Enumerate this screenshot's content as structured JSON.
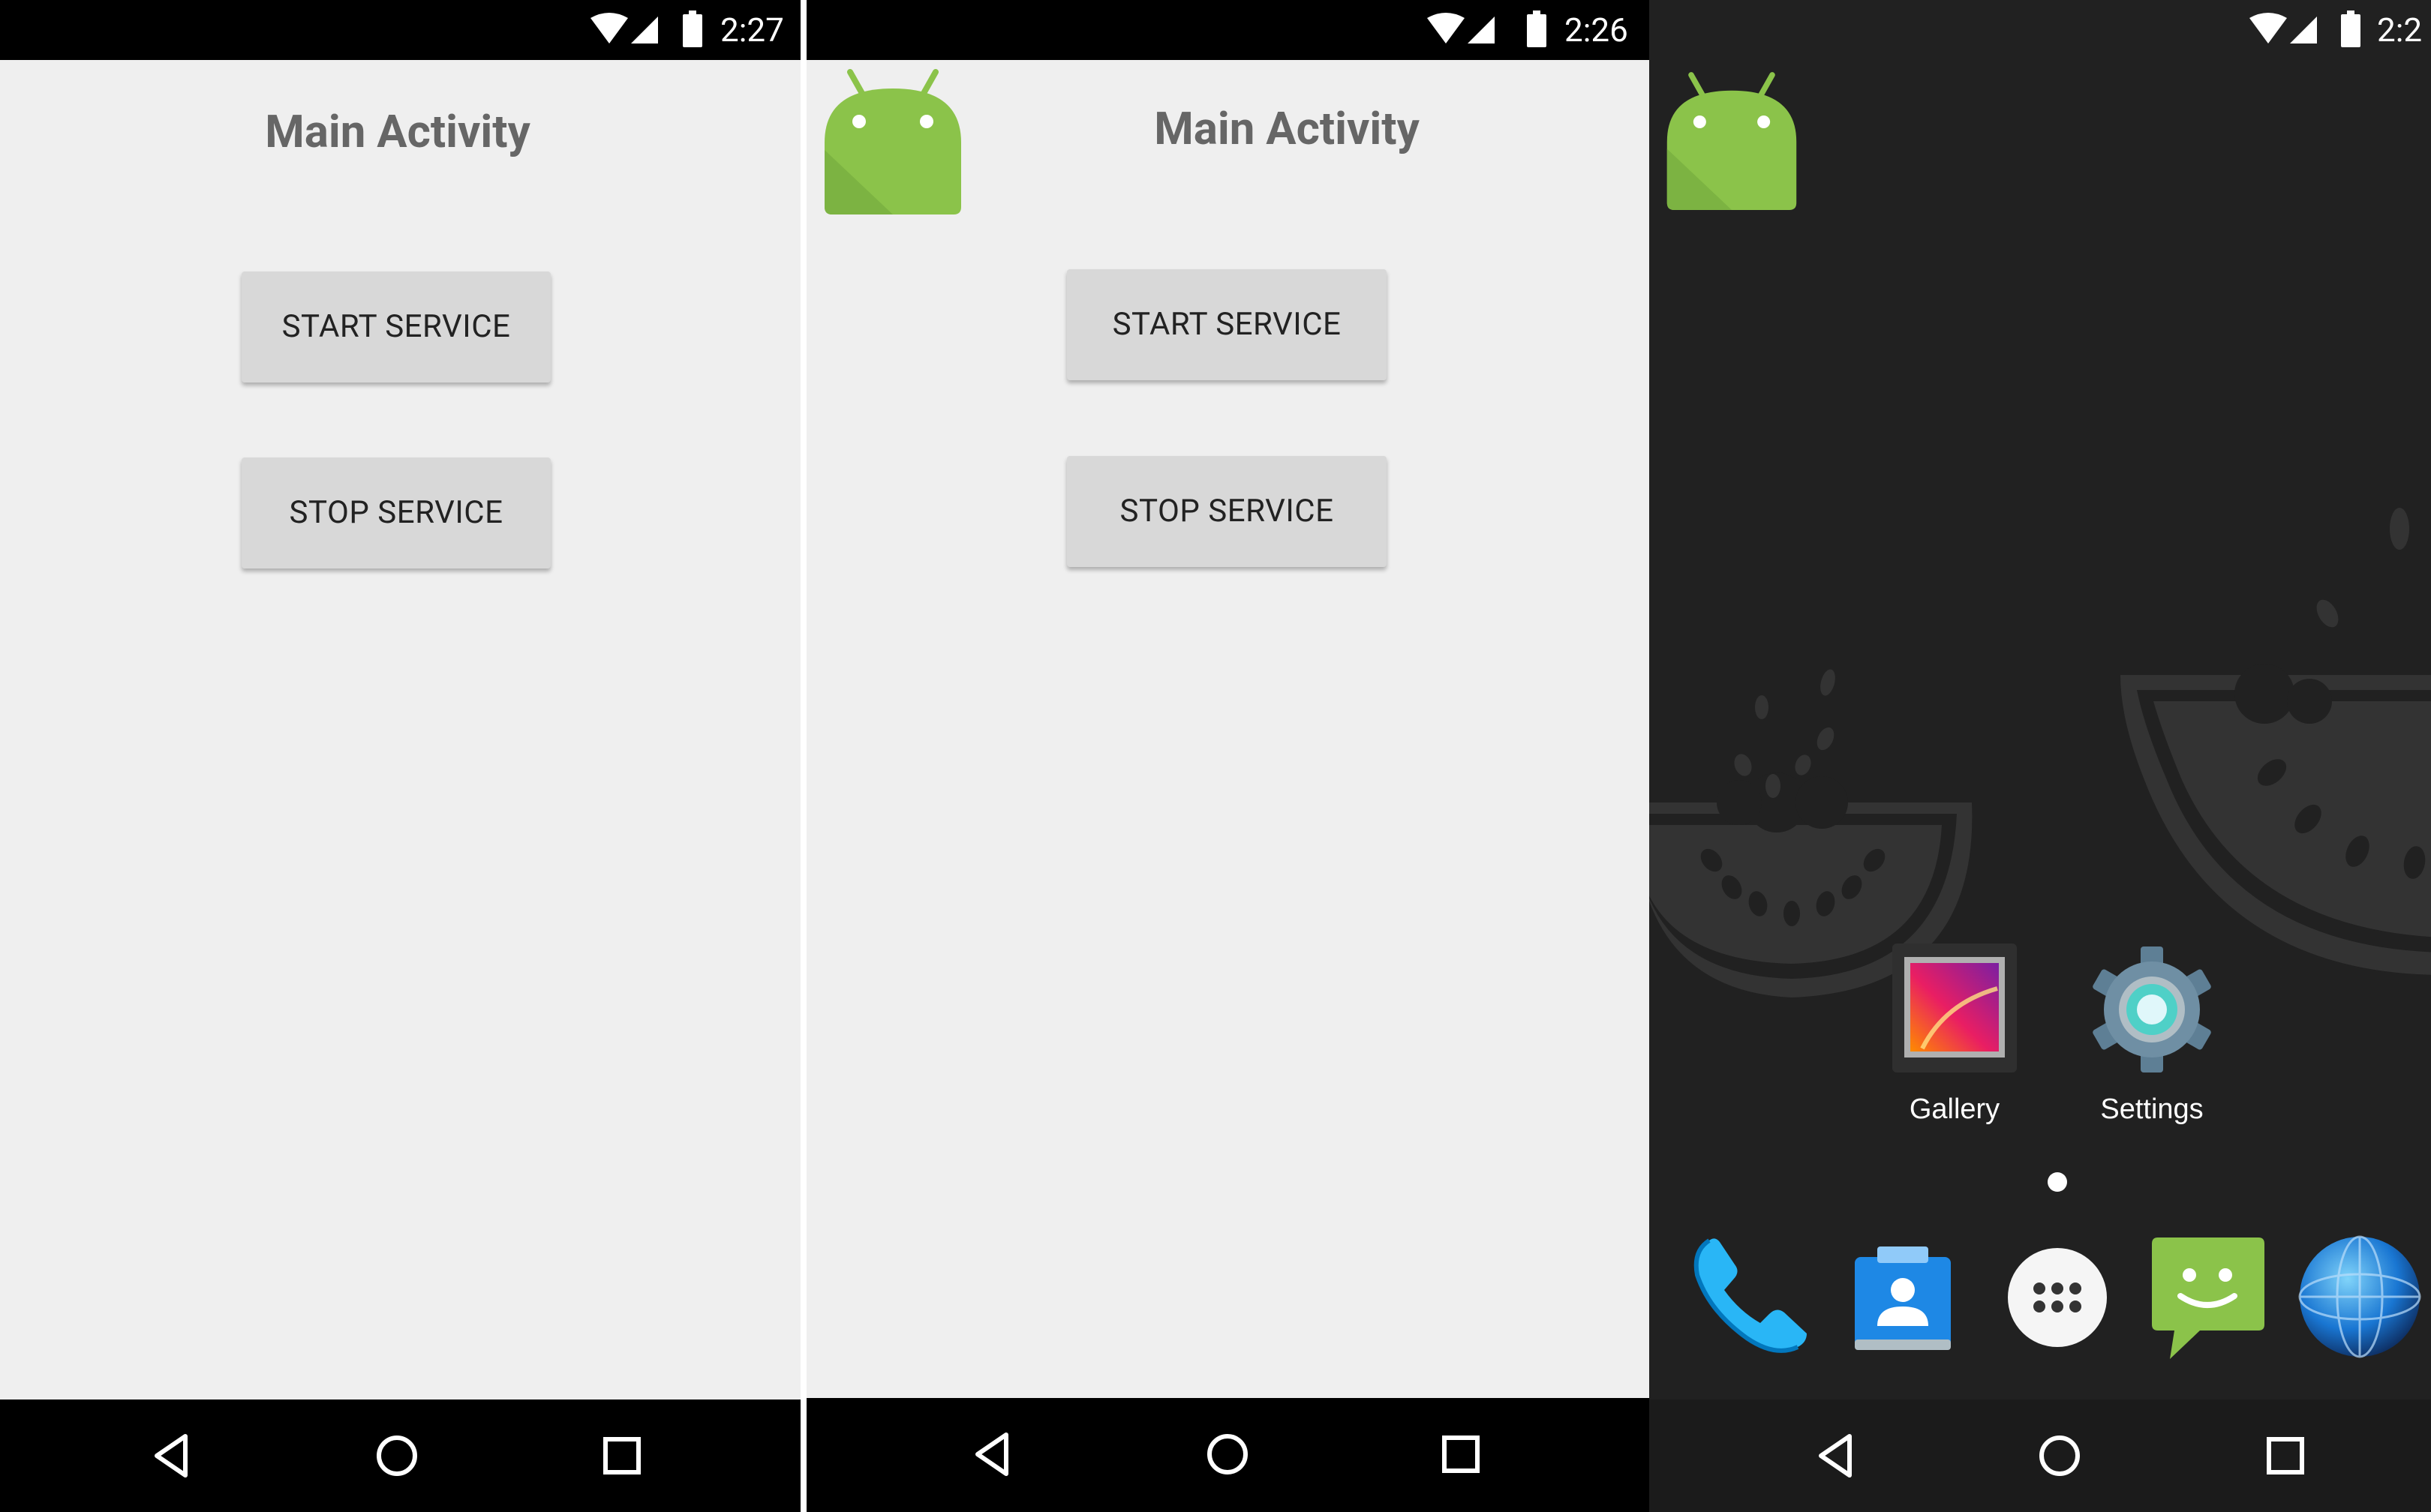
{
  "panels": [
    {
      "status_time": "2:27",
      "title": "Main Activity",
      "start_label": "START SERVICE",
      "stop_label": "STOP SERVICE"
    },
    {
      "status_time": "2:26",
      "title": "Main Activity",
      "start_label": "START SERVICE",
      "stop_label": "STOP SERVICE"
    },
    {
      "status_time": "2:2",
      "apps": [
        {
          "label": "Gallery",
          "icon": "gallery-icon"
        },
        {
          "label": "Settings",
          "icon": "settings-icon"
        }
      ],
      "dock": [
        "phone-icon",
        "contacts-icon",
        "app-drawer-icon",
        "messaging-icon",
        "browser-icon"
      ]
    }
  ],
  "nav": [
    "back-icon",
    "home-icon",
    "recents-icon"
  ],
  "colors": {
    "android_green": "#8bc34a",
    "activity_bg": "#efefef",
    "button_bg": "#d8d8d8",
    "launcher_bg": "#212121"
  }
}
